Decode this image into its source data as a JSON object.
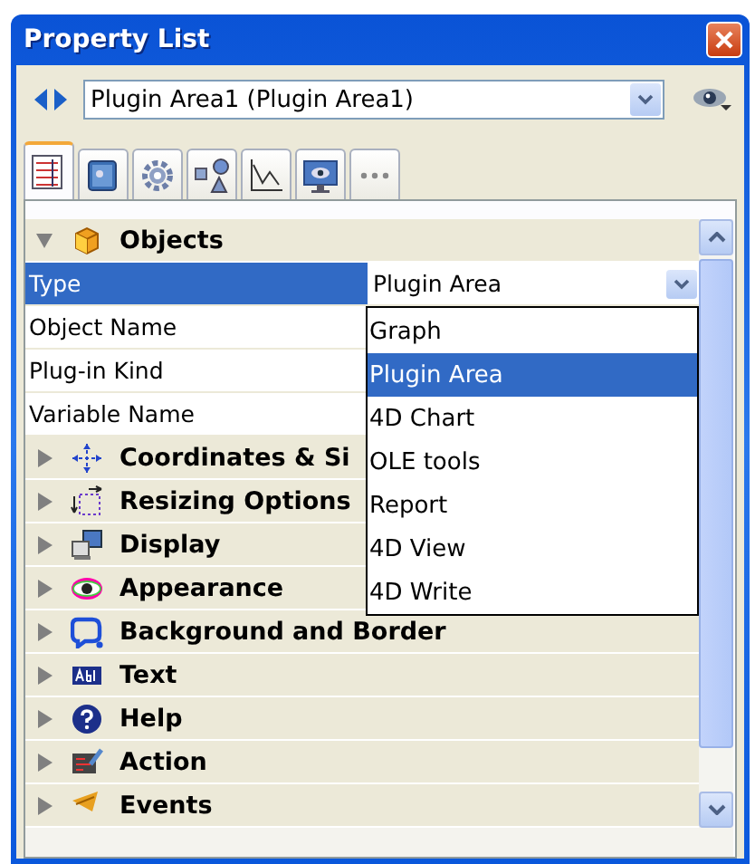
{
  "window": {
    "title": "Property List"
  },
  "object_selector": {
    "value": "Plugin Area1 (Plugin Area1)"
  },
  "tabs": [
    {
      "kind": "list",
      "selected": true
    },
    {
      "kind": "book",
      "selected": false
    },
    {
      "kind": "gear",
      "selected": false
    },
    {
      "kind": "shapes",
      "selected": false
    },
    {
      "kind": "chart",
      "selected": false
    },
    {
      "kind": "monitor",
      "selected": false
    },
    {
      "kind": "more",
      "selected": false
    }
  ],
  "sections": [
    {
      "title": "Objects",
      "kind": "cube",
      "expanded": true,
      "properties": [
        {
          "name": "Type",
          "value": "Plugin Area",
          "selected": true,
          "dropdown": {
            "options": [
              {
                "label": "Graph",
                "selected": false
              },
              {
                "label": "Plugin Area",
                "selected": true
              },
              {
                "label": "4D Chart",
                "selected": false
              },
              {
                "label": "OLE tools",
                "selected": false
              },
              {
                "label": "Report",
                "selected": false
              },
              {
                "label": "4D View",
                "selected": false
              },
              {
                "label": "4D Write",
                "selected": false
              }
            ]
          }
        },
        {
          "name": "Object Name",
          "selected": false
        },
        {
          "name": "Plug-in Kind",
          "selected": false
        },
        {
          "name": "Variable Name",
          "selected": false
        }
      ]
    },
    {
      "title": "Coordinates & Si",
      "kind": "coords",
      "expanded": false
    },
    {
      "title": "Resizing Options",
      "kind": "resize",
      "expanded": false
    },
    {
      "title": "Display",
      "kind": "display",
      "expanded": false
    },
    {
      "title": "Appearance",
      "kind": "eye",
      "expanded": false
    },
    {
      "title": "Background and Border",
      "kind": "border",
      "expanded": false
    },
    {
      "title": "Text",
      "kind": "text",
      "expanded": false
    },
    {
      "title": "Help",
      "kind": "help",
      "expanded": false
    },
    {
      "title": "Action",
      "kind": "action",
      "expanded": false
    },
    {
      "title": "Events",
      "kind": "events",
      "expanded": false
    }
  ]
}
